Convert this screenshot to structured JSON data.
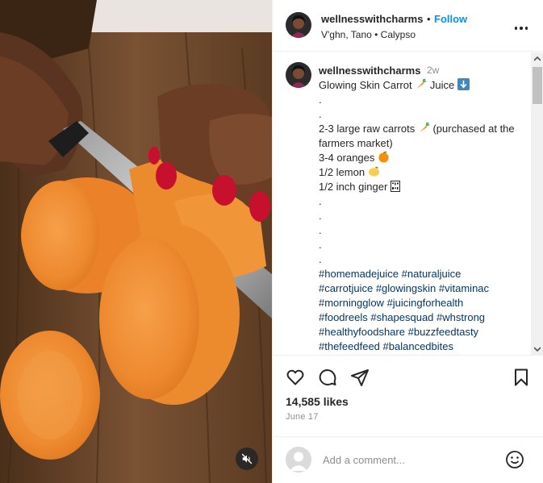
{
  "header": {
    "username": "wellnesswithcharms",
    "separator": "•",
    "follow_label": "Follow",
    "subtitle": "V'ghn, Tano • Calypso"
  },
  "caption": {
    "username": "wellnesswithcharms",
    "time_ago": "2w",
    "title": "Glowing Skin Carrot",
    "title_suffix": "Juice",
    "dot": ".",
    "lines": [
      "2-3 large raw carrots",
      "(purchased at the farmers market)",
      "3-4 oranges",
      "1/2 lemon",
      "1/2 inch ginger"
    ],
    "hashtags": [
      "#homemadejuice",
      "#naturaljuice",
      "#carrotjuice",
      "#glowingskin",
      "#vitaminac",
      "#morningglow",
      "#juicingforhealth",
      "#foodreels",
      "#shapesquad",
      "#whstrong",
      "#healthyfoodshare",
      "#buzzfeedtasty",
      "#thefeedfeed",
      "#balancedbites"
    ]
  },
  "icons": {
    "carrot": "carrot-emoji",
    "down_arrow": "down-arrow-emoji",
    "orange": "orange-emoji",
    "lemon": "lemon-emoji",
    "ginger": "ginger-missing-glyph",
    "like": "heart-icon",
    "comment": "comment-icon",
    "share": "paper-plane-icon",
    "save": "bookmark-icon",
    "mute": "muted-speaker-icon",
    "emoji": "smiley-icon"
  },
  "stats": {
    "likes": "14,585 likes",
    "date": "June 17"
  },
  "comment": {
    "placeholder": "Add a comment..."
  },
  "colors": {
    "link_blue": "#0095f6",
    "hashtag": "#00376b",
    "muted_text": "#8e8e8e",
    "border": "#efefef"
  }
}
